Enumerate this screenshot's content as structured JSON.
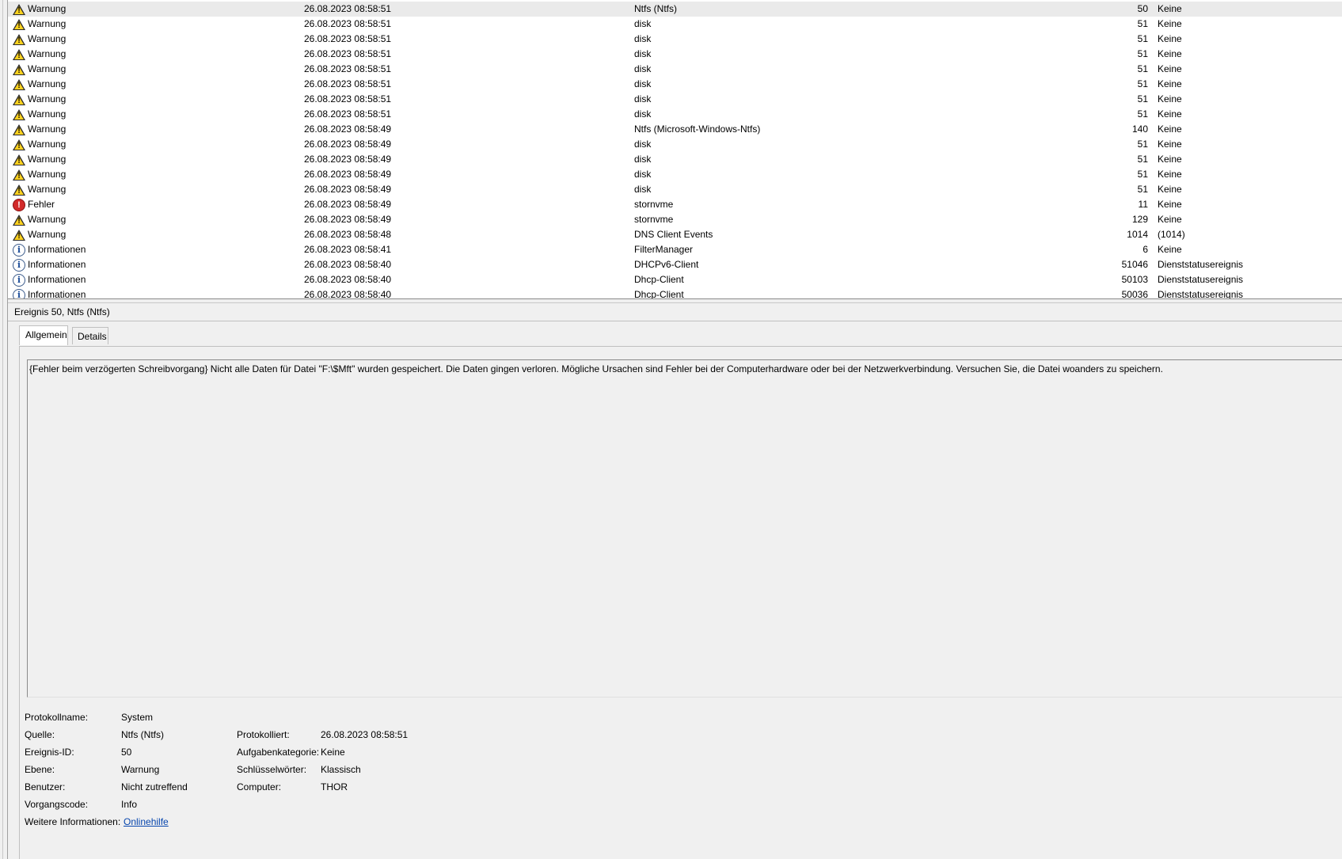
{
  "events": [
    {
      "level": "Warnung",
      "icon": "warning-icon",
      "date": "26.08.2023 08:58:51",
      "source": "Ntfs (Ntfs)",
      "id": "50",
      "task": "Keine"
    },
    {
      "level": "Warnung",
      "icon": "warning-icon",
      "date": "26.08.2023 08:58:51",
      "source": "disk",
      "id": "51",
      "task": "Keine"
    },
    {
      "level": "Warnung",
      "icon": "warning-icon",
      "date": "26.08.2023 08:58:51",
      "source": "disk",
      "id": "51",
      "task": "Keine"
    },
    {
      "level": "Warnung",
      "icon": "warning-icon",
      "date": "26.08.2023 08:58:51",
      "source": "disk",
      "id": "51",
      "task": "Keine"
    },
    {
      "level": "Warnung",
      "icon": "warning-icon",
      "date": "26.08.2023 08:58:51",
      "source": "disk",
      "id": "51",
      "task": "Keine"
    },
    {
      "level": "Warnung",
      "icon": "warning-icon",
      "date": "26.08.2023 08:58:51",
      "source": "disk",
      "id": "51",
      "task": "Keine"
    },
    {
      "level": "Warnung",
      "icon": "warning-icon",
      "date": "26.08.2023 08:58:51",
      "source": "disk",
      "id": "51",
      "task": "Keine"
    },
    {
      "level": "Warnung",
      "icon": "warning-icon",
      "date": "26.08.2023 08:58:51",
      "source": "disk",
      "id": "51",
      "task": "Keine"
    },
    {
      "level": "Warnung",
      "icon": "warning-icon",
      "date": "26.08.2023 08:58:49",
      "source": "Ntfs (Microsoft-Windows-Ntfs)",
      "id": "140",
      "task": "Keine"
    },
    {
      "level": "Warnung",
      "icon": "warning-icon",
      "date": "26.08.2023 08:58:49",
      "source": "disk",
      "id": "51",
      "task": "Keine"
    },
    {
      "level": "Warnung",
      "icon": "warning-icon",
      "date": "26.08.2023 08:58:49",
      "source": "disk",
      "id": "51",
      "task": "Keine"
    },
    {
      "level": "Warnung",
      "icon": "warning-icon",
      "date": "26.08.2023 08:58:49",
      "source": "disk",
      "id": "51",
      "task": "Keine"
    },
    {
      "level": "Warnung",
      "icon": "warning-icon",
      "date": "26.08.2023 08:58:49",
      "source": "disk",
      "id": "51",
      "task": "Keine"
    },
    {
      "level": "Fehler",
      "icon": "error-icon",
      "date": "26.08.2023 08:58:49",
      "source": "stornvme",
      "id": "11",
      "task": "Keine"
    },
    {
      "level": "Warnung",
      "icon": "warning-icon",
      "date": "26.08.2023 08:58:49",
      "source": "stornvme",
      "id": "129",
      "task": "Keine"
    },
    {
      "level": "Warnung",
      "icon": "warning-icon",
      "date": "26.08.2023 08:58:48",
      "source": "DNS Client Events",
      "id": "1014",
      "task": "(1014)"
    },
    {
      "level": "Informationen",
      "icon": "info-icon",
      "date": "26.08.2023 08:58:41",
      "source": "FilterManager",
      "id": "6",
      "task": "Keine"
    },
    {
      "level": "Informationen",
      "icon": "info-icon",
      "date": "26.08.2023 08:58:40",
      "source": "DHCPv6-Client",
      "id": "51046",
      "task": "Dienststatusereignis"
    },
    {
      "level": "Informationen",
      "icon": "info-icon",
      "date": "26.08.2023 08:58:40",
      "source": "Dhcp-Client",
      "id": "50103",
      "task": "Dienststatusereignis"
    },
    {
      "level": "Informationen",
      "icon": "info-icon",
      "date": "26.08.2023 08:58:40",
      "source": "Dhcp-Client",
      "id": "50036",
      "task": "Dienststatusereignis"
    }
  ],
  "detail": {
    "header": "Ereignis 50, Ntfs (Ntfs)",
    "tabs": [
      "Allgemein",
      "Details"
    ],
    "description": "{Fehler beim verzögerten Schreibvorgang} Nicht alle Daten für Datei \"F:\\$Mft\" wurden gespeichert. Die Daten gingen verloren. Mögliche Ursachen sind Fehler bei der Computerhardware oder bei der Netzwerkverbindung. Versuchen Sie, die Datei woanders zu speichern.",
    "props": {
      "log_name_label": "Protokollname:",
      "log_name": "System",
      "source_label": "Quelle:",
      "source": "Ntfs (Ntfs)",
      "logged_label": "Protokolliert:",
      "logged": "26.08.2023 08:58:51",
      "event_id_label": "Ereignis-ID:",
      "event_id": "50",
      "task_label": "Aufgabenkategorie:",
      "task": "Keine",
      "level_label": "Ebene:",
      "level": "Warnung",
      "keywords_label": "Schlüsselwörter:",
      "keywords": "Klassisch",
      "user_label": "Benutzer:",
      "user": "Nicht zutreffend",
      "computer_label": "Computer:",
      "computer": "THOR",
      "opcode_label": "Vorgangscode:",
      "opcode": "Info",
      "more_info_label": "Weitere Informationen:",
      "more_info_link": "Onlinehilfe"
    }
  }
}
